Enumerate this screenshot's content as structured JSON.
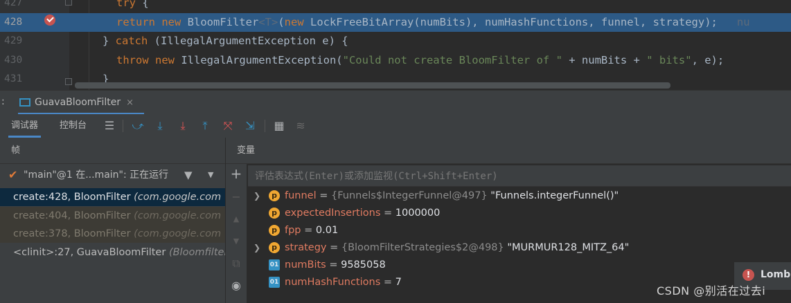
{
  "editor": {
    "lines": [
      {
        "num": "427",
        "tokens": [
          [
            "kw",
            "try"
          ],
          [
            "cls",
            " {"
          ]
        ]
      },
      {
        "num": "428",
        "tokens": [
          [
            "kw",
            "return new "
          ],
          [
            "cls",
            "BloomFilter"
          ],
          [
            "faint",
            "<T>"
          ],
          [
            "cls",
            "("
          ],
          [
            "kw",
            "new "
          ],
          [
            "cls",
            "LockFreeBitArray(numBits), numHashFunctions, funnel, strategy);"
          ],
          [
            "faint",
            "   nu"
          ]
        ]
      },
      {
        "num": "429",
        "tokens": [
          [
            "cls",
            "} "
          ],
          [
            "kw",
            "catch "
          ],
          [
            "cls",
            "(IllegalArgumentException e) {"
          ]
        ]
      },
      {
        "num": "430",
        "tokens": [
          [
            "kw",
            "throw new "
          ],
          [
            "cls",
            "IllegalArgumentException("
          ],
          [
            "str",
            "\"Could not create BloomFilter of \""
          ],
          [
            "cls",
            " + numBits + "
          ],
          [
            "str",
            "\" bits\""
          ],
          [
            "cls",
            ", e);"
          ]
        ]
      },
      {
        "num": "431",
        "tokens": [
          [
            "cls",
            "}"
          ]
        ]
      }
    ]
  },
  "tool_window": {
    "prefix": ":",
    "tab_label": "GuavaBloomFilter",
    "close_glyph": "×"
  },
  "debugger": {
    "tab_debugger": "调试器",
    "tab_console": "控制台"
  },
  "frames": {
    "header": "帧",
    "thread": "\"main\"@1 在...main\": 正在运行",
    "items": [
      {
        "label": "create:428, BloomFilter ",
        "pkg": "(com.google.com"
      },
      {
        "label": "create:404, BloomFilter ",
        "pkg": "(com.google.com"
      },
      {
        "label": "create:378, BloomFilter ",
        "pkg": "(com.google.com"
      },
      {
        "label": "<clinit>:27, GuavaBloomFilter ",
        "pkg": "(Bloomfilter"
      }
    ]
  },
  "variables": {
    "header": "变量",
    "eval_placeholder": "评估表达式(Enter)或添加监视(Ctrl+Shift+Enter)",
    "items": [
      {
        "expandable": true,
        "icon": "p",
        "name": "funnel",
        "type": "{Funnels$IntegerFunnel@497}",
        "value": " \"Funnels.integerFunnel()\""
      },
      {
        "expandable": false,
        "icon": "p",
        "name": "expectedInsertions",
        "type": "",
        "value": "1000000"
      },
      {
        "expandable": false,
        "icon": "p",
        "name": "fpp",
        "type": "",
        "value": "0.01"
      },
      {
        "expandable": true,
        "icon": "p",
        "name": "strategy",
        "type": "{BloomFilterStrategies$2@498}",
        "value": " \"MURMUR128_MITZ_64\""
      },
      {
        "expandable": false,
        "icon": "f",
        "name": "numBits",
        "type": "",
        "value": "9585058"
      },
      {
        "expandable": false,
        "icon": "f",
        "name": "numHashFunctions",
        "type": "",
        "value": "7"
      }
    ]
  },
  "notification": {
    "label": "Lomb"
  },
  "watermark": "CSDN @别活在过去i",
  "colors": {
    "accent": "#4a88c7",
    "highlight": "#2d5a86",
    "selected_frame": "#0d293e",
    "breakpoint": "#c75450"
  }
}
